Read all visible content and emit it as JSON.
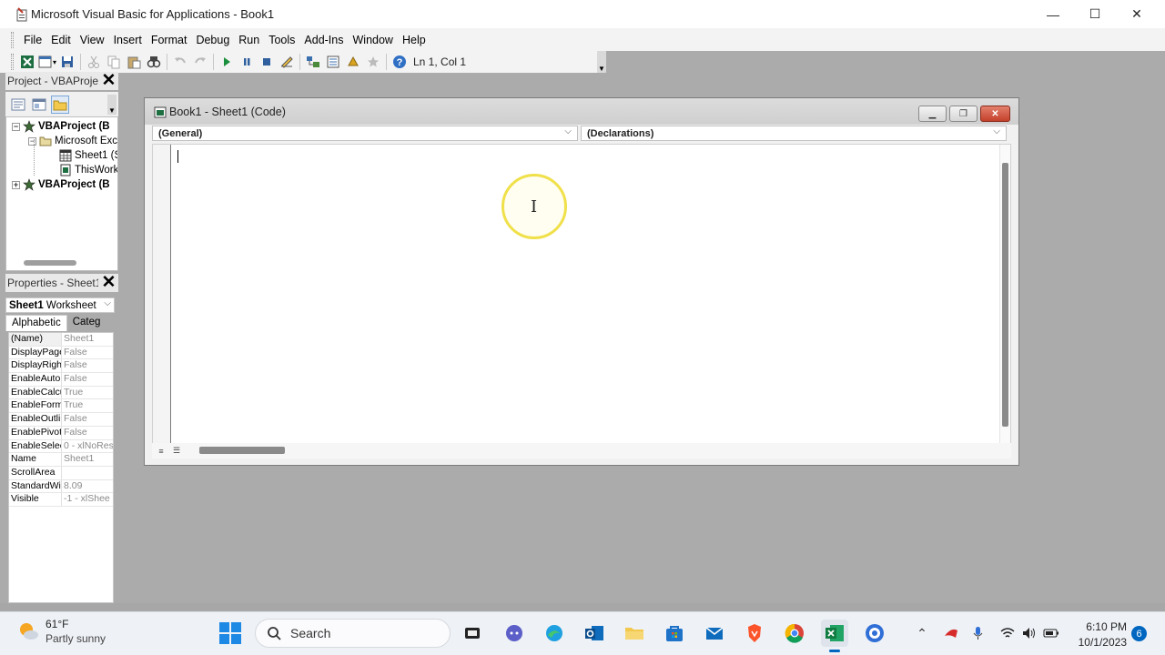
{
  "window": {
    "title": "Microsoft Visual Basic for Applications - Book1",
    "minimize": "—",
    "maximize": "☐",
    "close": "✕"
  },
  "menu": {
    "items": [
      "File",
      "Edit",
      "View",
      "Insert",
      "Format",
      "Debug",
      "Run",
      "Tools",
      "Add-Ins",
      "Window",
      "Help"
    ]
  },
  "toolbar": {
    "position_label": "Ln 1, Col 1",
    "buttons": [
      "view-excel",
      "insert-userform",
      "save",
      "cut",
      "copy",
      "paste",
      "find",
      "undo",
      "redo",
      "run",
      "break",
      "reset",
      "design-mode",
      "project-explorer",
      "properties-window",
      "object-browser",
      "toolbox",
      "help"
    ]
  },
  "project_pane": {
    "title": "Project - VBAProject",
    "tree": [
      {
        "label": "VBAProject (B",
        "level": 0,
        "expanded": true,
        "bold": true,
        "icon": "vba-project-icon"
      },
      {
        "label": "Microsoft Exc",
        "level": 1,
        "expanded": true,
        "bold": false,
        "icon": "folder-icon"
      },
      {
        "label": "Sheet1 (S",
        "level": 2,
        "bold": false,
        "icon": "worksheet-icon"
      },
      {
        "label": "ThisWork",
        "level": 2,
        "bold": false,
        "icon": "workbook-icon"
      },
      {
        "label": "VBAProject (B",
        "level": 0,
        "expanded": false,
        "bold": true,
        "icon": "vba-project-icon"
      }
    ]
  },
  "properties_pane": {
    "title": "Properties - Sheet1",
    "object_name": "Sheet1",
    "object_type": "Worksheet",
    "tabs": [
      "Alphabetic",
      "Categ"
    ],
    "rows": [
      {
        "name": "(Name)",
        "value": "Sheet1"
      },
      {
        "name": "DisplayPage",
        "value": "False"
      },
      {
        "name": "DisplayRight",
        "value": "False"
      },
      {
        "name": "EnableAutoF",
        "value": "False"
      },
      {
        "name": "EnableCalcu",
        "value": "True"
      },
      {
        "name": "EnableForm",
        "value": "True"
      },
      {
        "name": "EnableOutlin",
        "value": "False"
      },
      {
        "name": "EnablePivot",
        "value": "False"
      },
      {
        "name": "EnableSelect",
        "value": "0 - xlNoRes"
      },
      {
        "name": "Name",
        "value": "Sheet1"
      },
      {
        "name": "ScrollArea",
        "value": ""
      },
      {
        "name": "StandardWi",
        "value": "8.09"
      },
      {
        "name": "Visible",
        "value": "-1 - xlShee"
      }
    ]
  },
  "code_window": {
    "title": "Book1 - Sheet1 (Code)",
    "object_combo": "(General)",
    "procedure_combo": "(Declarations)",
    "content": ""
  },
  "taskbar": {
    "weather_temp": "61°F",
    "weather_desc": "Partly sunny",
    "search_label": "Search",
    "apps": [
      "task-view",
      "teams-chat",
      "edge",
      "outlook",
      "file-explorer",
      "store",
      "mail",
      "brave",
      "chrome",
      "excel",
      "vpn"
    ],
    "time": "6:10 PM",
    "date": "10/1/2023",
    "notification_count": "6"
  },
  "colors": {
    "workspace": "#ababab",
    "accent": "#0067c0",
    "excel_green": "#1d6f42",
    "close_red": "#c4412b",
    "cursor_highlight": "#f0e04a"
  }
}
